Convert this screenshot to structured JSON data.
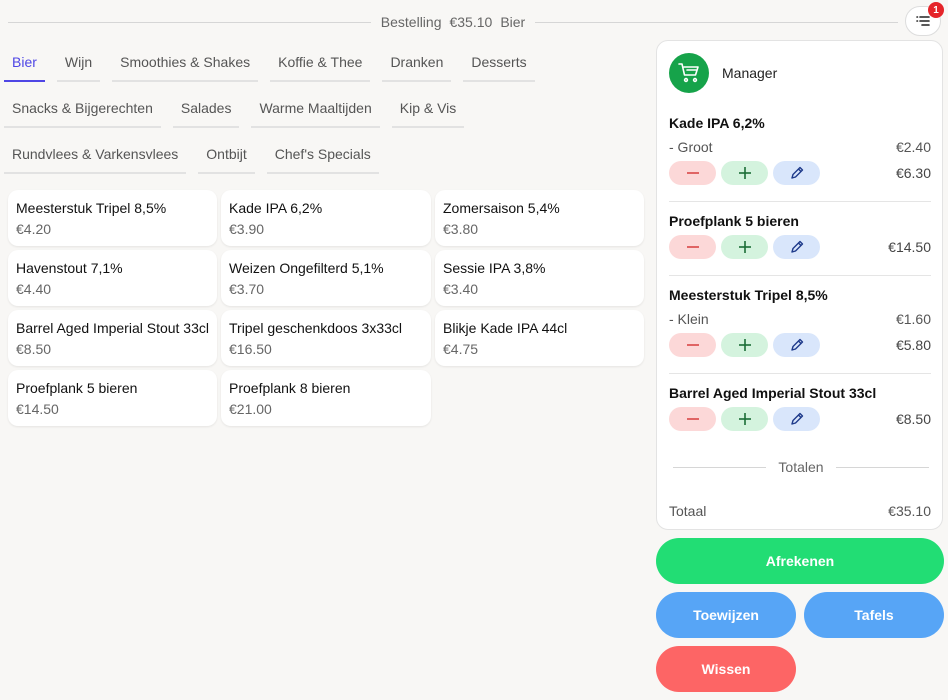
{
  "header": {
    "label": "Bestelling",
    "amount": "€35.10",
    "category": "Bier",
    "filter_badge": "1"
  },
  "categories": [
    [
      "Bier",
      "Wijn",
      "Smoothies & Shakes",
      "Koffie & Thee",
      "Dranken",
      "Desserts"
    ],
    [
      "Snacks & Bijgerechten",
      "Salades",
      "Warme Maaltijden",
      "Kip & Vis"
    ],
    [
      "Rundvlees & Varkensvlees",
      "Ontbijt",
      "Chef's Specials"
    ]
  ],
  "active_category": "Bier",
  "products": [
    {
      "name": "Meesterstuk Tripel 8,5%",
      "price": "€4.20"
    },
    {
      "name": "Kade IPA 6,2%",
      "price": "€3.90"
    },
    {
      "name": "Zomersaison 5,4%",
      "price": "€3.80"
    },
    {
      "name": "Havenstout 7,1%",
      "price": "€4.40"
    },
    {
      "name": "Weizen Ongefilterd 5,1%",
      "price": "€3.70"
    },
    {
      "name": "Sessie IPA 3,8%",
      "price": "€3.40"
    },
    {
      "name": "Barrel Aged Imperial Stout 33cl",
      "price": "€8.50"
    },
    {
      "name": "Tripel geschenkdoos 3x33cl",
      "price": "€16.50"
    },
    {
      "name": "Blikje Kade IPA 44cl",
      "price": "€4.75"
    },
    {
      "name": "Proefplank 5 bieren",
      "price": "€14.50"
    },
    {
      "name": "Proefplank 8 bieren",
      "price": "€21.00"
    }
  ],
  "order": {
    "user": "Manager",
    "items": [
      {
        "name": "Kade IPA 6,2%",
        "option": "- Groot",
        "option_price": "€2.40",
        "total": "€6.30"
      },
      {
        "name": "Proefplank 5 bieren",
        "option": "",
        "option_price": "",
        "total": "€14.50"
      },
      {
        "name": "Meesterstuk Tripel 8,5%",
        "option": "- Klein",
        "option_price": "€1.60",
        "total": "€5.80"
      },
      {
        "name": "Barrel Aged Imperial Stout 33cl",
        "option": "",
        "option_price": "",
        "total": "€8.50"
      }
    ],
    "totals_label": "Totalen",
    "grand_label": "Totaal",
    "grand_total": "€35.10"
  },
  "actions": {
    "checkout": "Afrekenen",
    "assign": "Toewijzen",
    "tables": "Tafels",
    "clear": "Wissen"
  },
  "colors": {
    "accent": "#4f46e5",
    "checkout": "#22dd74",
    "secondary": "#57a5f6",
    "danger": "#fd6565",
    "cart": "#16a34a"
  }
}
